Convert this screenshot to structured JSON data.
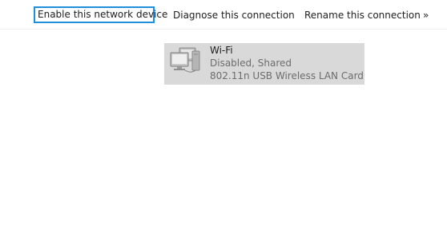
{
  "toolbar": {
    "enable_label": "Enable this network device",
    "diagnose_label": "Diagnose this connection",
    "rename_label": "Rename this connection",
    "more_label": "»"
  },
  "adapter": {
    "name": "Wi-Fi",
    "status": "Disabled, Shared",
    "device": "802.11n USB Wireless LAN Card",
    "icon": "network-adapter-icon"
  },
  "colors": {
    "selection_border": "#1e8fd8",
    "adapter_background": "#d9d9d9"
  }
}
